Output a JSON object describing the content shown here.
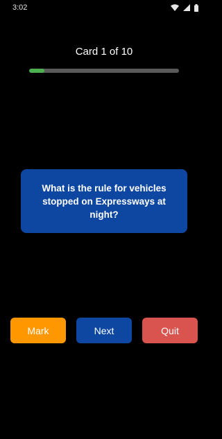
{
  "status_bar": {
    "time": "3:02",
    "icons": [
      "wifi-icon",
      "cellular-signal-icon",
      "battery-icon"
    ]
  },
  "progress": {
    "label": "Card 1 of 10",
    "fraction": 0.1,
    "fill_color": "#4caf50",
    "track_color": "#5a5a5a"
  },
  "card": {
    "question": "What is the rule for vehicles stopped on Expressways at night?",
    "color": "#0d47a1"
  },
  "buttons": {
    "mark": {
      "label": "Mark",
      "color": "#ff9800"
    },
    "next": {
      "label": "Next",
      "color": "#0d47a1"
    },
    "quit": {
      "label": "Quit",
      "color": "#d9534f"
    }
  }
}
